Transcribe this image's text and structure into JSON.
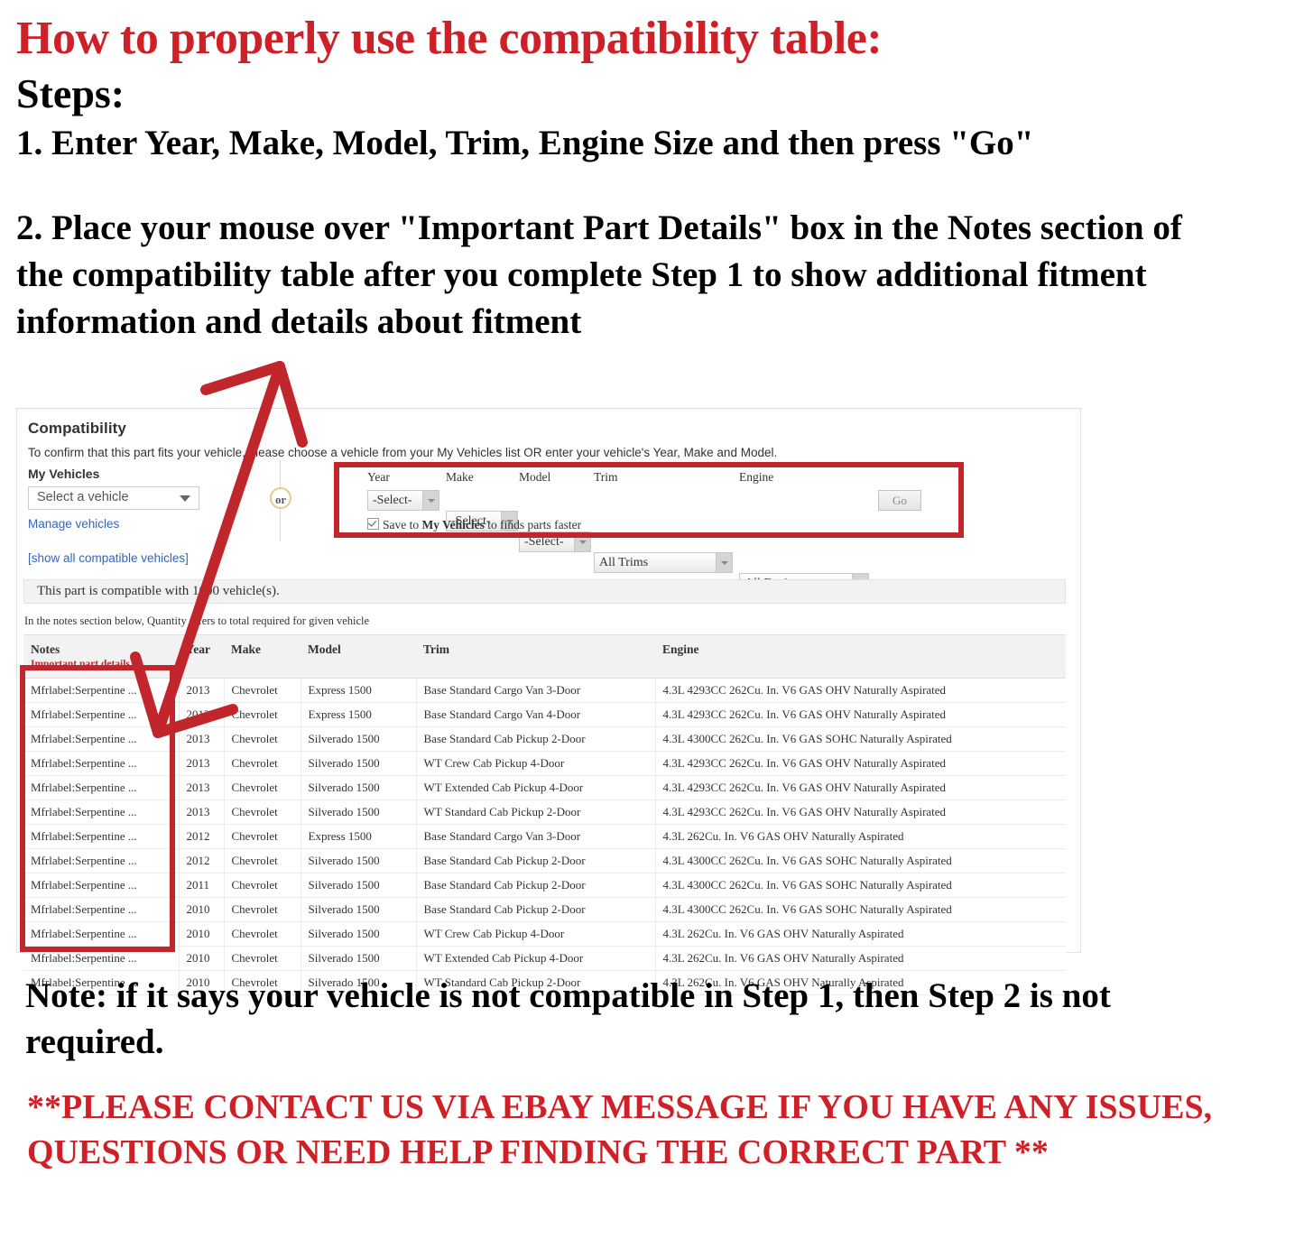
{
  "instructions": {
    "headline": "How to properly use the compatibility table:",
    "steps_label": "Steps:",
    "step1": "1. Enter Year, Make, Model, Trim, Engine Size and then press \"Go\"",
    "step2": "2. Place your mouse over \"Important Part Details\" box in the Notes section of the compatibility table after you complete Step 1 to show additional fitment information and details about fitment",
    "note": "Note: if it says your vehicle is not compatible in Step 1, then Step 2 is not required.",
    "contact": "**PLEASE CONTACT US VIA EBAY MESSAGE IF YOU HAVE ANY ISSUES, QUESTIONS OR NEED HELP FINDING THE CORRECT PART **"
  },
  "colors": {
    "headline_red": "#cf2027",
    "annotation_red": "#c1262c",
    "link_blue": "#3665b7",
    "notes_sub_red": "#c0272d",
    "or_circle_border": "#ddcc8e"
  },
  "compatibility": {
    "title": "Compatibility",
    "subtitle": "To confirm that this part fits your vehicle, please choose a vehicle from your My Vehicles list OR enter your vehicle's Year, Make and Model.",
    "my_vehicles_label": "My Vehicles",
    "vehicle_select_value": "Select a vehicle",
    "manage_vehicles_link": "Manage vehicles",
    "show_all_link": "[show all compatible vehicles]",
    "or_text": "or",
    "banner": "This part is compatible with 1000 vehicle(s).",
    "quantity_note": "In the notes section below, Quantity refers to total required for given vehicle",
    "finder": {
      "fields": [
        {
          "label": "Year",
          "value": "-Select-"
        },
        {
          "label": "Make",
          "value": "-Select-"
        },
        {
          "label": "Model",
          "value": "-Select-"
        },
        {
          "label": "Trim",
          "value": "All Trims"
        },
        {
          "label": "Engine",
          "value": "All Engines"
        }
      ],
      "go_label": "Go",
      "save_prefix": "Save to ",
      "save_bold": "My Vehicles",
      "save_suffix": " to finds parts faster",
      "save_checked": true
    },
    "table": {
      "headers": {
        "notes": "Notes",
        "notes_sub": "Important part details",
        "year": "Year",
        "make": "Make",
        "model": "Model",
        "trim": "Trim",
        "engine": "Engine"
      },
      "rows": [
        {
          "notes": "Mfrlabel:Serpentine ...",
          "year": "2013",
          "make": "Chevrolet",
          "model": "Express 1500",
          "trim": "Base Standard Cargo Van 3-Door",
          "engine": "4.3L 4293CC 262Cu. In. V6 GAS OHV Naturally Aspirated"
        },
        {
          "notes": "Mfrlabel:Serpentine ...",
          "year": "2013",
          "make": "Chevrolet",
          "model": "Express 1500",
          "trim": "Base Standard Cargo Van 4-Door",
          "engine": "4.3L 4293CC 262Cu. In. V6 GAS OHV Naturally Aspirated"
        },
        {
          "notes": "Mfrlabel:Serpentine ...",
          "year": "2013",
          "make": "Chevrolet",
          "model": "Silverado 1500",
          "trim": "Base Standard Cab Pickup 2-Door",
          "engine": "4.3L 4300CC 262Cu. In. V6 GAS SOHC Naturally Aspirated"
        },
        {
          "notes": "Mfrlabel:Serpentine ...",
          "year": "2013",
          "make": "Chevrolet",
          "model": "Silverado 1500",
          "trim": "WT Crew Cab Pickup 4-Door",
          "engine": "4.3L 4293CC 262Cu. In. V6 GAS OHV Naturally Aspirated"
        },
        {
          "notes": "Mfrlabel:Serpentine ...",
          "year": "2013",
          "make": "Chevrolet",
          "model": "Silverado 1500",
          "trim": "WT Extended Cab Pickup 4-Door",
          "engine": "4.3L 4293CC 262Cu. In. V6 GAS OHV Naturally Aspirated"
        },
        {
          "notes": "Mfrlabel:Serpentine ...",
          "year": "2013",
          "make": "Chevrolet",
          "model": "Silverado 1500",
          "trim": "WT Standard Cab Pickup 2-Door",
          "engine": "4.3L 4293CC 262Cu. In. V6 GAS OHV Naturally Aspirated"
        },
        {
          "notes": "Mfrlabel:Serpentine ...",
          "year": "2012",
          "make": "Chevrolet",
          "model": "Express 1500",
          "trim": "Base Standard Cargo Van 3-Door",
          "engine": "4.3L 262Cu. In. V6 GAS OHV Naturally Aspirated"
        },
        {
          "notes": "Mfrlabel:Serpentine ...",
          "year": "2012",
          "make": "Chevrolet",
          "model": "Silverado 1500",
          "trim": "Base Standard Cab Pickup 2-Door",
          "engine": "4.3L 4300CC 262Cu. In. V6 GAS SOHC Naturally Aspirated"
        },
        {
          "notes": "Mfrlabel:Serpentine ...",
          "year": "2011",
          "make": "Chevrolet",
          "model": "Silverado 1500",
          "trim": "Base Standard Cab Pickup 2-Door",
          "engine": "4.3L 4300CC 262Cu. In. V6 GAS SOHC Naturally Aspirated"
        },
        {
          "notes": "Mfrlabel:Serpentine ...",
          "year": "2010",
          "make": "Chevrolet",
          "model": "Silverado 1500",
          "trim": "Base Standard Cab Pickup 2-Door",
          "engine": "4.3L 4300CC 262Cu. In. V6 GAS SOHC Naturally Aspirated"
        },
        {
          "notes": "Mfrlabel:Serpentine ...",
          "year": "2010",
          "make": "Chevrolet",
          "model": "Silverado 1500",
          "trim": "WT Crew Cab Pickup 4-Door",
          "engine": "4.3L 262Cu. In. V6 GAS OHV Naturally Aspirated"
        },
        {
          "notes": "Mfrlabel:Serpentine ...",
          "year": "2010",
          "make": "Chevrolet",
          "model": "Silverado 1500",
          "trim": "WT Extended Cab Pickup 4-Door",
          "engine": "4.3L 262Cu. In. V6 GAS OHV Naturally Aspirated"
        },
        {
          "notes": "Mfrlabel:Serpentine ...",
          "year": "2010",
          "make": "Chevrolet",
          "model": "Silverado 1500",
          "trim": "WT Standard Cab Pickup 2-Door",
          "engine": "4.3L 262Cu. In. V6 GAS OHV Naturally Aspirated"
        }
      ]
    }
  }
}
